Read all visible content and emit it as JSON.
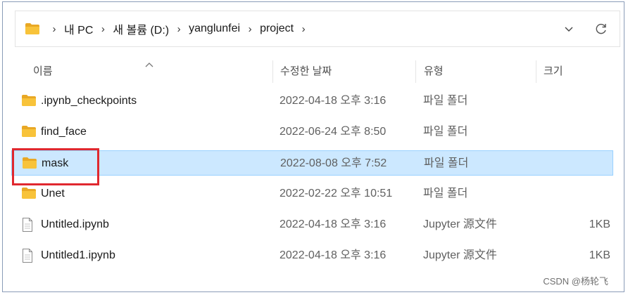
{
  "addressbar": {
    "crumbs": [
      "내 PC",
      "새 볼륨 (D:)",
      "yanglunfei",
      "project"
    ]
  },
  "columns": {
    "name": "이름",
    "date": "수정한 날짜",
    "type": "유형",
    "size": "크기"
  },
  "files": [
    {
      "name": ".ipynb_checkpoints",
      "date": "2022-04-18 오후 3:16",
      "type": "파일 폴더",
      "size": "",
      "icon": "folder-icon",
      "selected": false
    },
    {
      "name": "find_face",
      "date": "2022-06-24 오후 8:50",
      "type": "파일 폴더",
      "size": "",
      "icon": "folder-icon",
      "selected": false
    },
    {
      "name": "mask",
      "date": "2022-08-08 오후 7:52",
      "type": "파일 폴더",
      "size": "",
      "icon": "folder-icon",
      "selected": true
    },
    {
      "name": "Unet",
      "date": "2022-02-22 오후 10:51",
      "type": "파일 폴더",
      "size": "",
      "icon": "folder-icon",
      "selected": false
    },
    {
      "name": "Untitled.ipynb",
      "date": "2022-04-18 오후 3:16",
      "type": "Jupyter 源文件",
      "size": "1KB",
      "icon": "file-icon",
      "selected": false
    },
    {
      "name": "Untitled1.ipynb",
      "date": "2022-04-18 오후 3:16",
      "type": "Jupyter 源文件",
      "size": "1KB",
      "icon": "file-icon",
      "selected": false
    }
  ],
  "watermark": "CSDN @杨轮飞",
  "colors": {
    "folder": "#f8c33a",
    "selection": "#cce8ff",
    "highlight": "#e0282f"
  }
}
